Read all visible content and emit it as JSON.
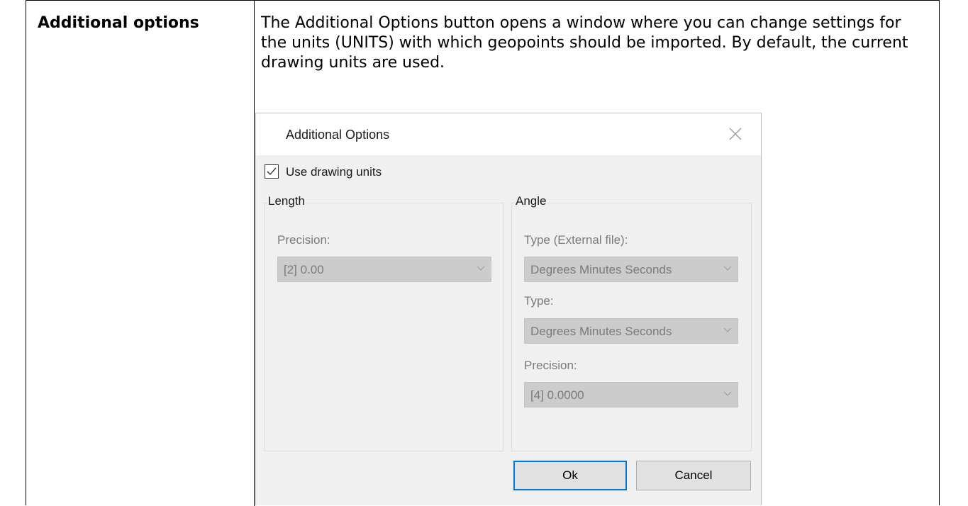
{
  "doc": {
    "term": "Additional options",
    "description": "The Additional Options button opens a window where you can change settings for the units (UNITS) with which geopoints should be imported. By default, the current drawing units are used."
  },
  "dialog": {
    "title": "Additional Options",
    "use_drawing_units": {
      "label": "Use drawing units",
      "checked": true
    },
    "length": {
      "legend": "Length",
      "precision_label": "Precision:",
      "precision_value": "[2] 0.00"
    },
    "angle": {
      "legend": "Angle",
      "type_external_label": "Type (External file):",
      "type_external_value": "Degrees Minutes Seconds",
      "type_label": "Type:",
      "type_value": "Degrees Minutes Seconds",
      "precision_label": "Precision:",
      "precision_value": "[4] 0.0000"
    },
    "ok_label": "Ok",
    "cancel_label": "Cancel"
  },
  "icons": [
    "close-icon",
    "checkmark-icon",
    "chevron-down-icon"
  ],
  "colors": {
    "focus_border": "#0078d7",
    "disabled_combo": "#cccccc",
    "dialog_bg": "#f0f0f0"
  }
}
